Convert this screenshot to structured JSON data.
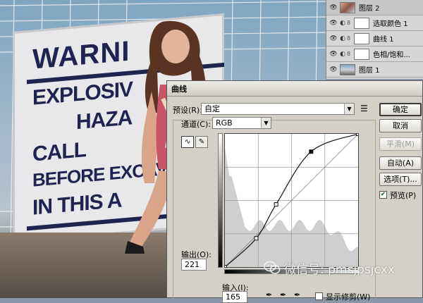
{
  "layers_panel": {
    "layers": [
      {
        "name": "图层 2",
        "kind": "photo",
        "has_mask": false,
        "selected": true
      },
      {
        "name": "选取颜色 1",
        "kind": "adjustment",
        "has_mask": true
      },
      {
        "name": "曲线 1",
        "kind": "adjustment",
        "has_mask": true
      },
      {
        "name": "色相/饱和...",
        "kind": "adjustment",
        "has_mask": true
      },
      {
        "name": "图层 1",
        "kind": "image",
        "has_mask": false
      }
    ]
  },
  "sign": {
    "lines": [
      "WARNI",
      "EXPLOSIV",
      "HAZA",
      "CALL",
      "BEFORE EXCAVA",
      "IN THIS A"
    ]
  },
  "dialog": {
    "title": "曲线",
    "preset_label": "预设(R):",
    "preset_value": "自定",
    "channel_label": "通道(C):",
    "channel_value": "RGB",
    "buttons": {
      "ok": "确定",
      "cancel": "取消",
      "smooth": "平滑(M)",
      "auto": "自动(A)",
      "options": "选项(T)..."
    },
    "preview_label": "预览(P)",
    "preview_checked": true,
    "output_label": "输出(O):",
    "output_value": "221",
    "input_label": "输入(I):",
    "input_value": "165",
    "show_clipping_label": "显示修剪(W)",
    "preset_menu_icon": "menu-lines-icon",
    "pencil_icon": "pencil-icon",
    "curve_icon": "curve-tool-icon",
    "eyedropper_icons": [
      "black-eyedropper-icon",
      "gray-eyedropper-icon",
      "white-eyedropper-icon"
    ]
  },
  "curve": {
    "points": [
      [
        0,
        0
      ],
      [
        60,
        55
      ],
      [
        98,
        120
      ],
      [
        165,
        221
      ],
      [
        255,
        255
      ]
    ],
    "selected_index": 3
  },
  "watermark": {
    "text": "微信号: pmsjpsjcxx"
  },
  "colors": {
    "dialog_bg": "#d4d0c8",
    "sign_text": "#1f2350"
  }
}
